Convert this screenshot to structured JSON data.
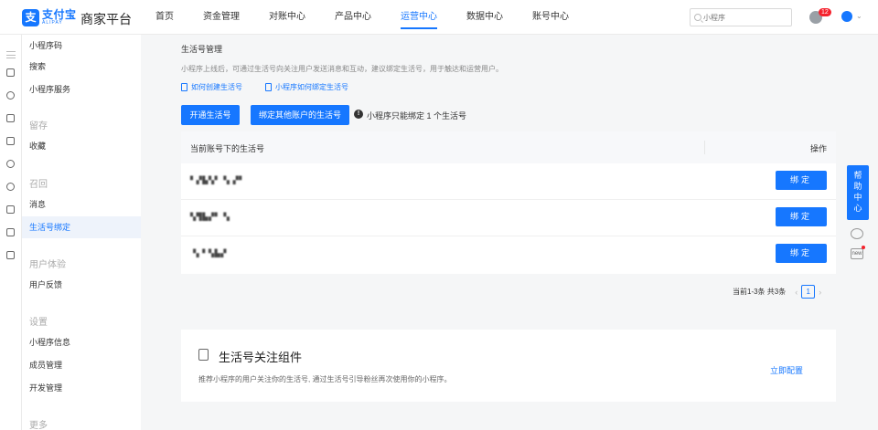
{
  "brand": {
    "logo_cn": "支付宝",
    "logo_en": "ALIPAY",
    "logo_mark": "支",
    "platform": "商家平台"
  },
  "nav": [
    "首页",
    "资金管理",
    "对账中心",
    "产品中心",
    "运营中心",
    "数据中心",
    "账号中心"
  ],
  "nav_active": "运营中心",
  "search": {
    "placeholder": "小程序"
  },
  "notifications": {
    "count": "12"
  },
  "sidebar": {
    "items_top": [
      "小程序码",
      "搜索",
      "小程序服务"
    ],
    "group_retain": "留存",
    "retain_items": [
      "收藏"
    ],
    "group_recall": "召回",
    "recall_items": [
      "消息",
      "生活号绑定"
    ],
    "group_experience": "用户体验",
    "experience_items": [
      "用户反馈"
    ],
    "group_settings": "设置",
    "settings_items": [
      "小程序信息",
      "成员管理",
      "开发管理"
    ],
    "group_more": "更多"
  },
  "main": {
    "title": "生活号管理",
    "description": "小程序上线后，可通过生活号向关注用户发送消息和互动，建议绑定生活号，用于触达和运营用户。",
    "link_create": "如何创建生活号",
    "link_bind": "小程序如何绑定生活号",
    "btn_open": "开通生活号",
    "btn_bind_other": "绑定其他账户的生活号",
    "info_icon": "!",
    "info": "小程序只能绑定 1 个生活号"
  },
  "table": {
    "col_name": "当前账号下的生活号",
    "col_action": "操作",
    "rows": [
      {
        "name": "▘▞▙▚▘▝▖▞▘",
        "action": "绑定"
      },
      {
        "name": "▚▜▙▞▘▝▖",
        "action": "绑定"
      },
      {
        "name": "▝▖▘▚▙▞",
        "action": "绑定"
      }
    ]
  },
  "pagination": {
    "summary": "当前1-3条 共3条",
    "prev": "‹",
    "next": "›",
    "current": "1"
  },
  "card": {
    "title": "生活号关注组件",
    "description": "推荐小程序的用户关注你的生活号, 通过生活号引导粉丝再次使用你的小程序。",
    "link": "立即配置"
  },
  "float": {
    "help": [
      "帮",
      "助",
      "中",
      "心"
    ],
    "new": "new"
  },
  "colors": {
    "primary": "#1677ff",
    "badge": "#f5222d"
  }
}
